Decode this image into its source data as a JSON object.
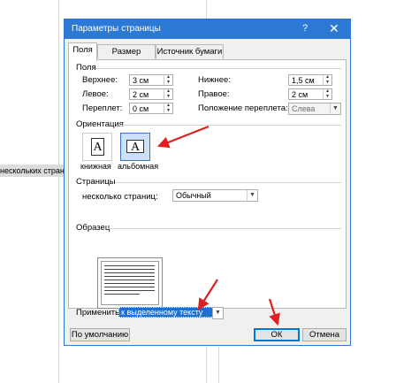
{
  "background": {
    "doc_snippet": "нескольких страниц в W"
  },
  "dialog": {
    "title": "Параметры страницы",
    "help_label": "?",
    "close_label": "✕",
    "tabs": [
      {
        "label": "Поля"
      },
      {
        "label": "Размер бумаги"
      },
      {
        "label": "Источник бумаги"
      }
    ],
    "margins": {
      "section_label": "Поля",
      "top": {
        "label": "Верхнее:",
        "value": "3 см"
      },
      "bottom": {
        "label": "Нижнее:",
        "value": "1,5 см"
      },
      "left": {
        "label": "Левое:",
        "value": "2 см"
      },
      "right": {
        "label": "Правое:",
        "value": "2 см"
      },
      "gutter": {
        "label": "Переплет:",
        "value": "0 см"
      },
      "gutter_position": {
        "label": "Положение переплета:",
        "value": "Слева"
      }
    },
    "orientation": {
      "section_label": "Ориентация",
      "portrait_label": "книжная",
      "landscape_label": "альбомная",
      "icon_letter": "A"
    },
    "pages": {
      "section_label": "Страницы",
      "multiple_label": "несколько страниц:",
      "value": "Обычный"
    },
    "preview": {
      "section_label": "Образец"
    },
    "apply": {
      "label": "Применить:",
      "value": "к выделенному тексту"
    },
    "buttons": {
      "default_label": "По умолчанию",
      "ok_label": "ОК",
      "cancel_label": "Отмена"
    },
    "colors": {
      "accent": "#2b79d5",
      "arrow": "#e02020",
      "selection": "#1f6fd1"
    }
  }
}
